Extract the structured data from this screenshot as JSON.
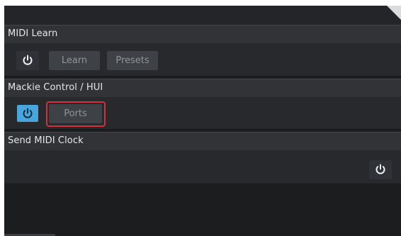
{
  "sections": [
    {
      "title": "MIDI Learn",
      "power_state": "off",
      "buttons": [
        "Learn",
        "Presets"
      ]
    },
    {
      "title": "Mackie Control / HUI",
      "power_state": "on",
      "buttons": [
        "Ports"
      ]
    },
    {
      "title": "Send MIDI Clock",
      "power_state": "off",
      "buttons": []
    }
  ],
  "colors": {
    "power_on": "#49a6dc",
    "highlight": "#d6303a"
  },
  "icons": {
    "power": "power-icon",
    "corner": "corner-fold-icon"
  }
}
